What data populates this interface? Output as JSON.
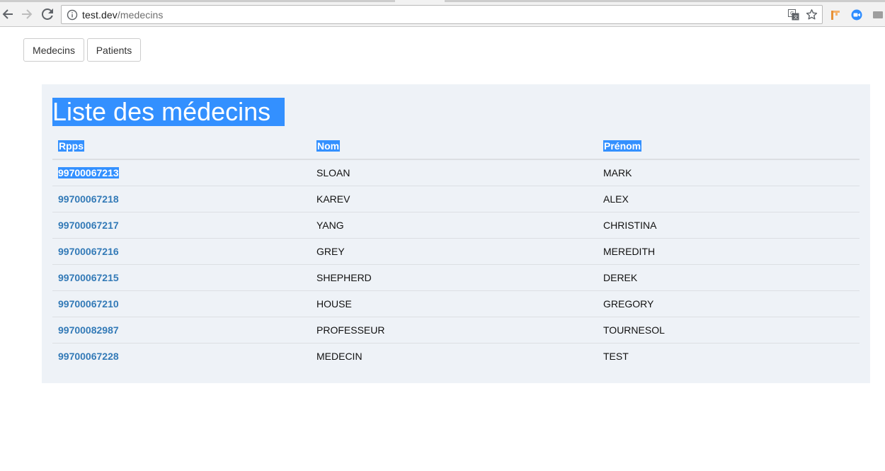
{
  "browser": {
    "url_host": "test.dev",
    "url_path": "/medecins"
  },
  "nav": {
    "medecins_label": "Medecins",
    "patients_label": "Patients"
  },
  "panel": {
    "title": "Liste des médecins "
  },
  "table": {
    "headers": [
      "Rpps",
      "Nom",
      "Prénom"
    ],
    "rows": [
      {
        "rpps": "99700067213",
        "nom": "SLOAN",
        "prenom": "MARK"
      },
      {
        "rpps": "99700067218",
        "nom": "KAREV",
        "prenom": "ALEX"
      },
      {
        "rpps": "99700067217",
        "nom": "YANG",
        "prenom": "CHRISTINA"
      },
      {
        "rpps": "99700067216",
        "nom": "GREY",
        "prenom": "MEREDITH"
      },
      {
        "rpps": "99700067215",
        "nom": "SHEPHERD",
        "prenom": "DEREK"
      },
      {
        "rpps": "99700067210",
        "nom": "HOUSE",
        "prenom": "GREGORY"
      },
      {
        "rpps": "99700082987",
        "nom": "PROFESSEUR",
        "prenom": "TOURNESOL"
      },
      {
        "rpps": "99700067228",
        "nom": "MEDECIN",
        "prenom": "TEST"
      }
    ]
  },
  "colors": {
    "selection": "#3390ff",
    "link": "#337ab7",
    "panel_bg": "#eef2f7"
  },
  "icons": [
    "back-arrow-icon",
    "forward-arrow-icon",
    "reload-icon",
    "info-icon",
    "translate-icon",
    "star-icon",
    "extension-icon",
    "zoom-icon",
    "cast-icon"
  ]
}
